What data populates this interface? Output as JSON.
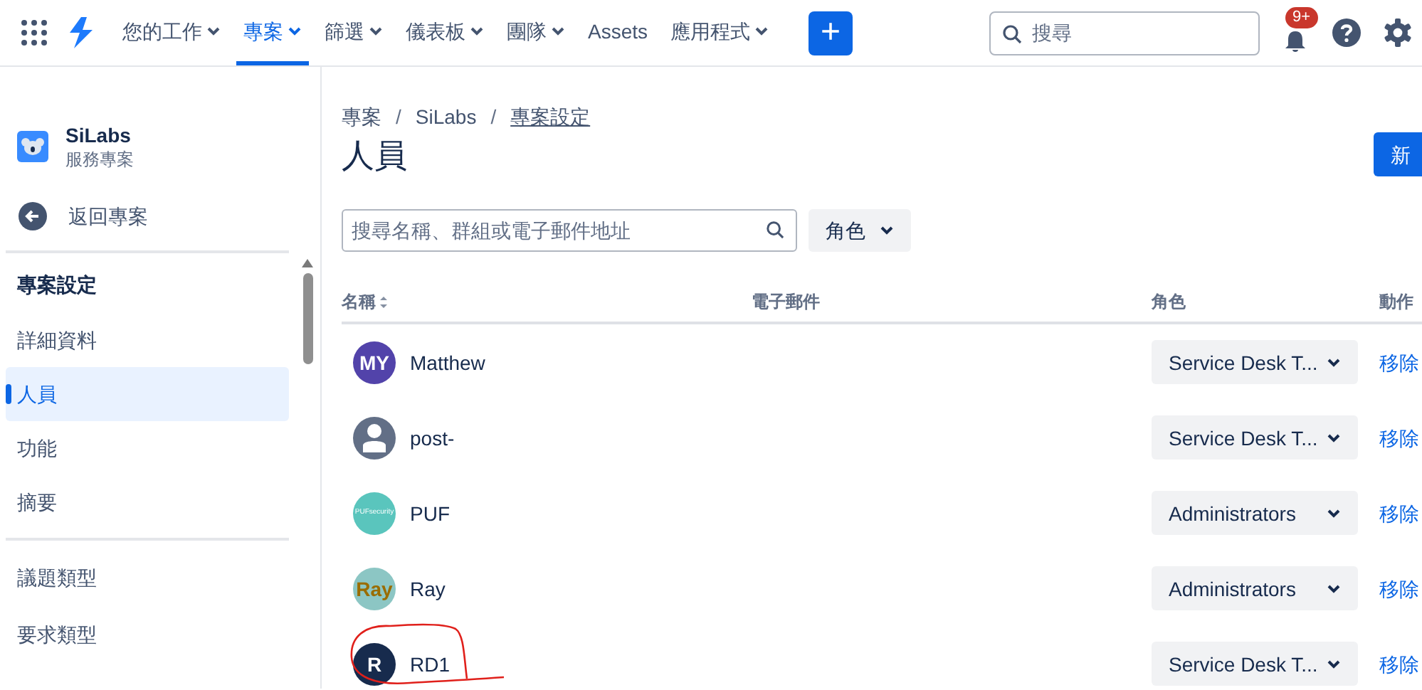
{
  "nav": {
    "items": [
      {
        "label": "您的工作",
        "dropdown": true,
        "selected": false
      },
      {
        "label": "專案",
        "dropdown": true,
        "selected": true
      },
      {
        "label": "篩選",
        "dropdown": true,
        "selected": false
      },
      {
        "label": "儀表板",
        "dropdown": true,
        "selected": false
      },
      {
        "label": "團隊",
        "dropdown": true,
        "selected": false
      },
      {
        "label": "Assets",
        "dropdown": false,
        "selected": false
      },
      {
        "label": "應用程式",
        "dropdown": true,
        "selected": false
      }
    ],
    "create_button": "+",
    "search": {
      "placeholder": "搜尋"
    },
    "notification_badge": "9+"
  },
  "sidebar": {
    "project": {
      "name": "SiLabs",
      "type": "服務專案"
    },
    "back": "返回專案",
    "section": "專案設定",
    "groups": [
      [
        {
          "label": "詳細資料",
          "selected": false
        },
        {
          "label": "人員",
          "selected": true
        },
        {
          "label": "功能",
          "selected": false
        },
        {
          "label": "摘要",
          "selected": false
        }
      ],
      [
        {
          "label": "議題類型",
          "selected": false
        },
        {
          "label": "要求類型",
          "selected": false
        }
      ]
    ]
  },
  "breadcrumbs": [
    {
      "label": "專案",
      "link": false
    },
    {
      "separator_before": "/",
      "label": "SiLabs",
      "link": false
    },
    {
      "separator_before": "/",
      "label": "專案設定",
      "link": true
    }
  ],
  "title": "人員",
  "add_button": "新",
  "search": {
    "placeholder": "搜尋名稱、群組或電子郵件地址"
  },
  "role_filter": "角色",
  "table": {
    "columns": [
      "名稱",
      "電子郵件",
      "角色",
      "動作"
    ],
    "rows": [
      {
        "avatar": {
          "kind": "initials",
          "text": "MY",
          "color": "#5243aa"
        },
        "name": "Matthew",
        "role": "Service Desk T...",
        "action": "移除",
        "circled": false
      },
      {
        "avatar": {
          "kind": "silhouette",
          "color": "#626f86"
        },
        "name": "post-",
        "role": "Service Desk T...",
        "action": "移除",
        "circled": false
      },
      {
        "avatar": {
          "kind": "logo",
          "text": "PUFsecurity",
          "color": "#5ac5bd"
        },
        "name": "PUF",
        "role": "Administrators",
        "action": "移除",
        "circled": false
      },
      {
        "avatar": {
          "kind": "initials",
          "text": "Ray",
          "color": "#8cc6c4"
        },
        "name": "Ray",
        "role": "Administrators",
        "action": "移除",
        "circled": false
      },
      {
        "avatar": {
          "kind": "initials",
          "text": "R",
          "color": "#172b4d"
        },
        "name": "RD1",
        "role": "Service Desk T...",
        "action": "移除",
        "circled": true
      }
    ]
  }
}
